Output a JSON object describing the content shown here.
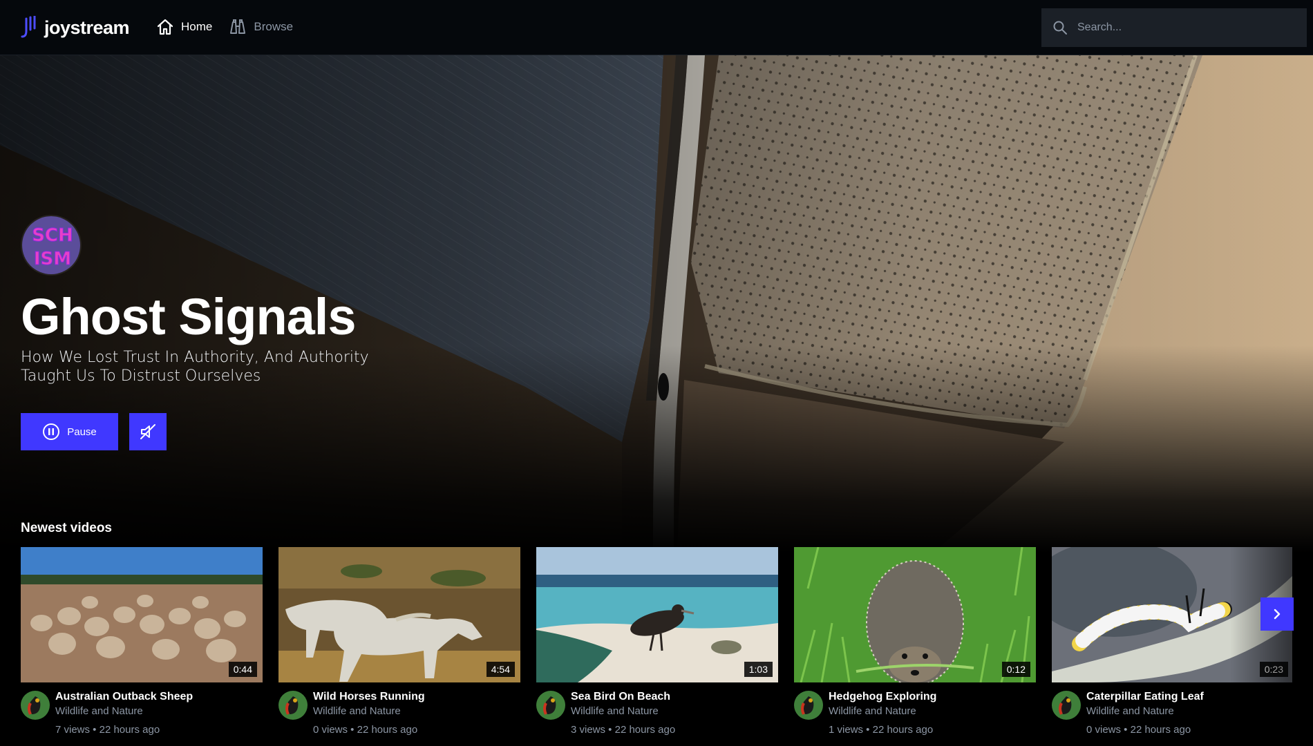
{
  "app": {
    "brand": "joystream"
  },
  "nav": {
    "home_label": "Home",
    "browse_label": "Browse"
  },
  "search": {
    "placeholder": "Search..."
  },
  "hero": {
    "title": "Ghost Signals",
    "subtitle": "How We Lost Trust In Authority, And Authority Taught Us To Distrust Ourselves",
    "pause_label": "Pause",
    "channel_avatar_text": "SCHISM"
  },
  "newest": {
    "heading": "Newest videos",
    "videos": [
      {
        "title": "Australian Outback Sheep",
        "channel": "Wildlife and Nature",
        "stats": "7 views • 22 hours ago",
        "duration": "0:44"
      },
      {
        "title": "Wild Horses Running",
        "channel": "Wildlife and Nature",
        "stats": "0 views • 22 hours ago",
        "duration": "4:54"
      },
      {
        "title": "Sea Bird On Beach",
        "channel": "Wildlife and Nature",
        "stats": "3 views • 22 hours ago",
        "duration": "1:03"
      },
      {
        "title": "Hedgehog Exploring",
        "channel": "Wildlife and Nature",
        "stats": "1 views • 22 hours ago",
        "duration": "0:12"
      },
      {
        "title": "Caterpillar Eating Leaf",
        "channel": "Wildlife and Nature",
        "stats": "0 views • 22 hours ago",
        "duration": "0:23"
      }
    ]
  },
  "colors": {
    "accent": "#4038ff",
    "topbar": "#05080c",
    "search_bg": "#1b2027",
    "muted_text": "#8c96a4"
  },
  "icons": {
    "logo": "joystream-logo-icon",
    "home": "home-icon",
    "browse": "binoculars-icon",
    "search": "search-icon",
    "pause": "pause-circle-icon",
    "mute": "speaker-off-icon",
    "next": "chevron-right-icon"
  }
}
